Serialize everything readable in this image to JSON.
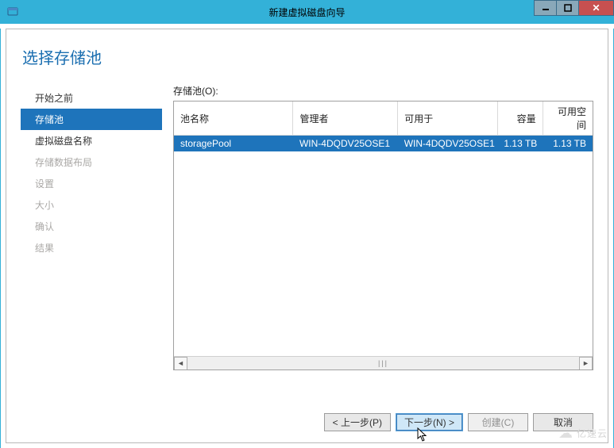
{
  "window": {
    "title": "新建虚拟磁盘向导"
  },
  "page": {
    "heading": "选择存储池"
  },
  "sidebar": {
    "steps": [
      {
        "label": "开始之前",
        "state": "completed"
      },
      {
        "label": "存储池",
        "state": "active"
      },
      {
        "label": "虚拟磁盘名称",
        "state": "completed"
      },
      {
        "label": "存储数据布局",
        "state": "upcoming"
      },
      {
        "label": "设置",
        "state": "upcoming"
      },
      {
        "label": "大小",
        "state": "upcoming"
      },
      {
        "label": "确认",
        "state": "upcoming"
      },
      {
        "label": "结果",
        "state": "upcoming"
      }
    ]
  },
  "main": {
    "list_label": "存储池(O):",
    "columns": {
      "name": "池名称",
      "manager": "管理者",
      "available_to": "可用于",
      "capacity": "容量",
      "free_space": "可用空间"
    },
    "rows": [
      {
        "name": "storagePool",
        "manager": "WIN-4DQDV25OSE1",
        "available_to": "WIN-4DQDV25OSE1",
        "capacity": "1.13 TB",
        "free_space": "1.13 TB"
      }
    ]
  },
  "footer": {
    "previous": "< 上一步(P)",
    "next": "下一步(N) >",
    "create": "创建(C)",
    "cancel": "取消"
  },
  "watermark": "亿速云"
}
